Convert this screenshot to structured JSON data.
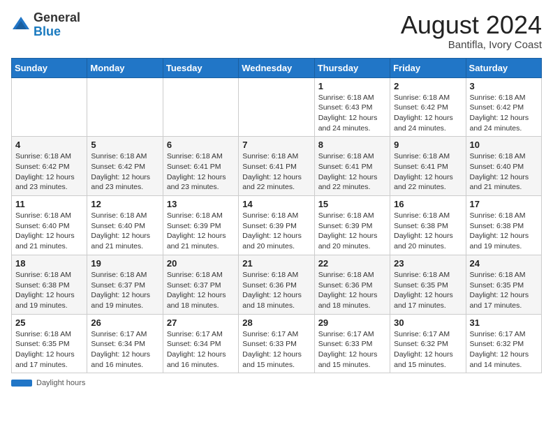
{
  "header": {
    "logo_general": "General",
    "logo_blue": "Blue",
    "title": "August 2024",
    "subtitle": "Bantifla, Ivory Coast"
  },
  "days_of_week": [
    "Sunday",
    "Monday",
    "Tuesday",
    "Wednesday",
    "Thursday",
    "Friday",
    "Saturday"
  ],
  "footer": {
    "label": "Daylight hours"
  },
  "weeks": [
    [
      {
        "day": "",
        "info": ""
      },
      {
        "day": "",
        "info": ""
      },
      {
        "day": "",
        "info": ""
      },
      {
        "day": "",
        "info": ""
      },
      {
        "day": "1",
        "info": "Sunrise: 6:18 AM\nSunset: 6:43 PM\nDaylight: 12 hours\nand 24 minutes."
      },
      {
        "day": "2",
        "info": "Sunrise: 6:18 AM\nSunset: 6:42 PM\nDaylight: 12 hours\nand 24 minutes."
      },
      {
        "day": "3",
        "info": "Sunrise: 6:18 AM\nSunset: 6:42 PM\nDaylight: 12 hours\nand 24 minutes."
      }
    ],
    [
      {
        "day": "4",
        "info": "Sunrise: 6:18 AM\nSunset: 6:42 PM\nDaylight: 12 hours\nand 23 minutes."
      },
      {
        "day": "5",
        "info": "Sunrise: 6:18 AM\nSunset: 6:42 PM\nDaylight: 12 hours\nand 23 minutes."
      },
      {
        "day": "6",
        "info": "Sunrise: 6:18 AM\nSunset: 6:41 PM\nDaylight: 12 hours\nand 23 minutes."
      },
      {
        "day": "7",
        "info": "Sunrise: 6:18 AM\nSunset: 6:41 PM\nDaylight: 12 hours\nand 22 minutes."
      },
      {
        "day": "8",
        "info": "Sunrise: 6:18 AM\nSunset: 6:41 PM\nDaylight: 12 hours\nand 22 minutes."
      },
      {
        "day": "9",
        "info": "Sunrise: 6:18 AM\nSunset: 6:41 PM\nDaylight: 12 hours\nand 22 minutes."
      },
      {
        "day": "10",
        "info": "Sunrise: 6:18 AM\nSunset: 6:40 PM\nDaylight: 12 hours\nand 21 minutes."
      }
    ],
    [
      {
        "day": "11",
        "info": "Sunrise: 6:18 AM\nSunset: 6:40 PM\nDaylight: 12 hours\nand 21 minutes."
      },
      {
        "day": "12",
        "info": "Sunrise: 6:18 AM\nSunset: 6:40 PM\nDaylight: 12 hours\nand 21 minutes."
      },
      {
        "day": "13",
        "info": "Sunrise: 6:18 AM\nSunset: 6:39 PM\nDaylight: 12 hours\nand 21 minutes."
      },
      {
        "day": "14",
        "info": "Sunrise: 6:18 AM\nSunset: 6:39 PM\nDaylight: 12 hours\nand 20 minutes."
      },
      {
        "day": "15",
        "info": "Sunrise: 6:18 AM\nSunset: 6:39 PM\nDaylight: 12 hours\nand 20 minutes."
      },
      {
        "day": "16",
        "info": "Sunrise: 6:18 AM\nSunset: 6:38 PM\nDaylight: 12 hours\nand 20 minutes."
      },
      {
        "day": "17",
        "info": "Sunrise: 6:18 AM\nSunset: 6:38 PM\nDaylight: 12 hours\nand 19 minutes."
      }
    ],
    [
      {
        "day": "18",
        "info": "Sunrise: 6:18 AM\nSunset: 6:38 PM\nDaylight: 12 hours\nand 19 minutes."
      },
      {
        "day": "19",
        "info": "Sunrise: 6:18 AM\nSunset: 6:37 PM\nDaylight: 12 hours\nand 19 minutes."
      },
      {
        "day": "20",
        "info": "Sunrise: 6:18 AM\nSunset: 6:37 PM\nDaylight: 12 hours\nand 18 minutes."
      },
      {
        "day": "21",
        "info": "Sunrise: 6:18 AM\nSunset: 6:36 PM\nDaylight: 12 hours\nand 18 minutes."
      },
      {
        "day": "22",
        "info": "Sunrise: 6:18 AM\nSunset: 6:36 PM\nDaylight: 12 hours\nand 18 minutes."
      },
      {
        "day": "23",
        "info": "Sunrise: 6:18 AM\nSunset: 6:35 PM\nDaylight: 12 hours\nand 17 minutes."
      },
      {
        "day": "24",
        "info": "Sunrise: 6:18 AM\nSunset: 6:35 PM\nDaylight: 12 hours\nand 17 minutes."
      }
    ],
    [
      {
        "day": "25",
        "info": "Sunrise: 6:18 AM\nSunset: 6:35 PM\nDaylight: 12 hours\nand 17 minutes."
      },
      {
        "day": "26",
        "info": "Sunrise: 6:17 AM\nSunset: 6:34 PM\nDaylight: 12 hours\nand 16 minutes."
      },
      {
        "day": "27",
        "info": "Sunrise: 6:17 AM\nSunset: 6:34 PM\nDaylight: 12 hours\nand 16 minutes."
      },
      {
        "day": "28",
        "info": "Sunrise: 6:17 AM\nSunset: 6:33 PM\nDaylight: 12 hours\nand 15 minutes."
      },
      {
        "day": "29",
        "info": "Sunrise: 6:17 AM\nSunset: 6:33 PM\nDaylight: 12 hours\nand 15 minutes."
      },
      {
        "day": "30",
        "info": "Sunrise: 6:17 AM\nSunset: 6:32 PM\nDaylight: 12 hours\nand 15 minutes."
      },
      {
        "day": "31",
        "info": "Sunrise: 6:17 AM\nSunset: 6:32 PM\nDaylight: 12 hours\nand 14 minutes."
      }
    ]
  ]
}
